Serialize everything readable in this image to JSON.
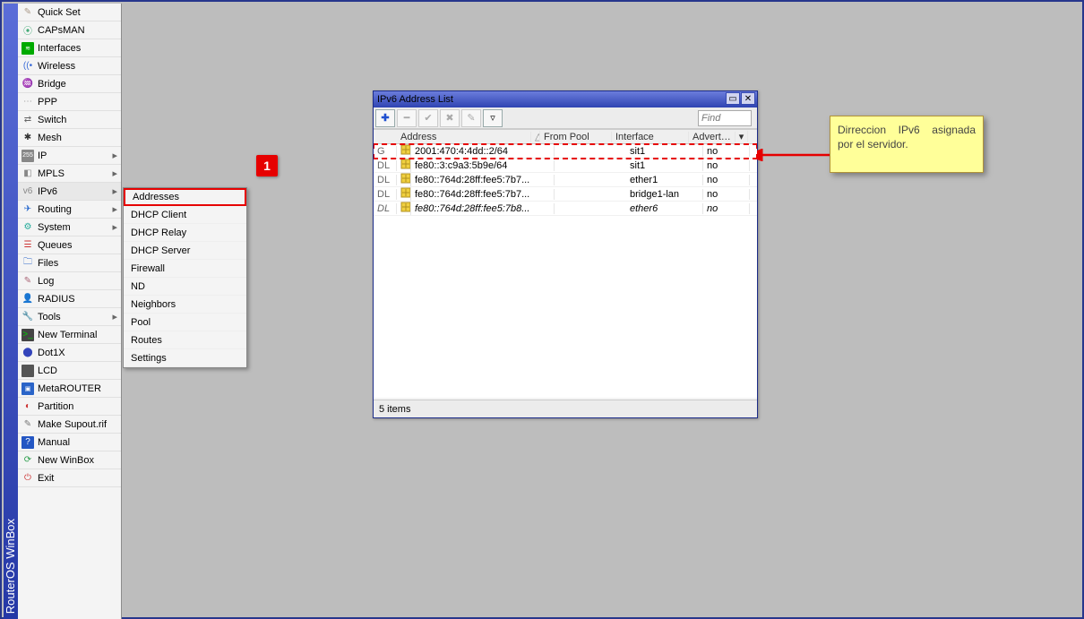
{
  "app_title": "RouterOS WinBox",
  "sidebar": {
    "items": [
      {
        "label": "Quick Set",
        "icon": "wand",
        "sub": false
      },
      {
        "label": "CAPsMAN",
        "icon": "cap",
        "sub": false
      },
      {
        "label": "Interfaces",
        "icon": "ifc",
        "sub": false
      },
      {
        "label": "Wireless",
        "icon": "wifi",
        "sub": false
      },
      {
        "label": "Bridge",
        "icon": "bridge",
        "sub": false
      },
      {
        "label": "PPP",
        "icon": "ppp",
        "sub": false
      },
      {
        "label": "Switch",
        "icon": "switch",
        "sub": false
      },
      {
        "label": "Mesh",
        "icon": "mesh",
        "sub": false
      },
      {
        "label": "IP",
        "icon": "ip",
        "sub": true
      },
      {
        "label": "MPLS",
        "icon": "mpls",
        "sub": true
      },
      {
        "label": "IPv6",
        "icon": "ipv6",
        "sub": true,
        "selected": true
      },
      {
        "label": "Routing",
        "icon": "route",
        "sub": true
      },
      {
        "label": "System",
        "icon": "sys",
        "sub": true
      },
      {
        "label": "Queues",
        "icon": "queue",
        "sub": false
      },
      {
        "label": "Files",
        "icon": "files",
        "sub": false
      },
      {
        "label": "Log",
        "icon": "log",
        "sub": false
      },
      {
        "label": "RADIUS",
        "icon": "radius",
        "sub": false
      },
      {
        "label": "Tools",
        "icon": "tools",
        "sub": true
      },
      {
        "label": "New Terminal",
        "icon": "term",
        "sub": false
      },
      {
        "label": "Dot1X",
        "icon": "dot1x",
        "sub": false
      },
      {
        "label": "LCD",
        "icon": "lcd",
        "sub": false
      },
      {
        "label": "MetaROUTER",
        "icon": "mr",
        "sub": false
      },
      {
        "label": "Partition",
        "icon": "part",
        "sub": false
      },
      {
        "label": "Make Supout.rif",
        "icon": "supout",
        "sub": false
      },
      {
        "label": "Manual",
        "icon": "manual",
        "sub": false
      },
      {
        "label": "New WinBox",
        "icon": "new",
        "sub": false
      },
      {
        "label": "Exit",
        "icon": "exit",
        "sub": false
      }
    ]
  },
  "submenu": {
    "items": [
      {
        "label": "Addresses",
        "highlighted": true
      },
      {
        "label": "DHCP Client"
      },
      {
        "label": "DHCP Relay"
      },
      {
        "label": "DHCP Server"
      },
      {
        "label": "Firewall"
      },
      {
        "label": "ND"
      },
      {
        "label": "Neighbors"
      },
      {
        "label": "Pool"
      },
      {
        "label": "Routes"
      },
      {
        "label": "Settings"
      }
    ]
  },
  "window": {
    "title": "IPv6 Address List",
    "find_placeholder": "Find",
    "columns": {
      "address": "Address",
      "from_pool": "From Pool",
      "interface": "Interface",
      "advertise": "Advertise"
    },
    "rows": [
      {
        "flag": "G",
        "address": "2001:470:4:4dd::2/64",
        "from_pool": "",
        "interface": "sit1",
        "advertise": "no",
        "highlight": true,
        "italic": false
      },
      {
        "flag": "DL",
        "address": "fe80::3:c9a3:5b9e/64",
        "from_pool": "",
        "interface": "sit1",
        "advertise": "no",
        "highlight": false,
        "italic": false
      },
      {
        "flag": "DL",
        "address": "fe80::764d:28ff:fee5:7b7...",
        "from_pool": "",
        "interface": "ether1",
        "advertise": "no",
        "highlight": false,
        "italic": false
      },
      {
        "flag": "DL",
        "address": "fe80::764d:28ff:fee5:7b7...",
        "from_pool": "",
        "interface": "bridge1-lan",
        "advertise": "no",
        "highlight": false,
        "italic": false
      },
      {
        "flag": "DL",
        "address": "fe80::764d:28ff:fee5:7b8...",
        "from_pool": "",
        "interface": "ether6",
        "advertise": "no",
        "highlight": false,
        "italic": true
      }
    ],
    "status": "5 items"
  },
  "annotation": {
    "badge": "1",
    "callout": "Dirreccion IPv6 asignada por el servidor."
  },
  "icons": {
    "wand": "✎",
    "cap": "⦿",
    "ifc": "≋",
    "wifi": "((•",
    "bridge": "♒",
    "ppp": "⋯",
    "switch": "⇄",
    "mesh": "✱",
    "ip": "255",
    "mpls": "◧",
    "ipv6": "v6",
    "route": "✈",
    "sys": "⚙",
    "queue": "☰",
    "files": "🗀",
    "log": "✎",
    "radius": "👤",
    "tools": "🔧",
    "term": ">_",
    "dot1x": "⬤",
    "lcd": " ",
    "mr": "▣",
    "part": "◐",
    "supout": "✎",
    "manual": "?",
    "new": "⟳",
    "exit": "⏻"
  }
}
